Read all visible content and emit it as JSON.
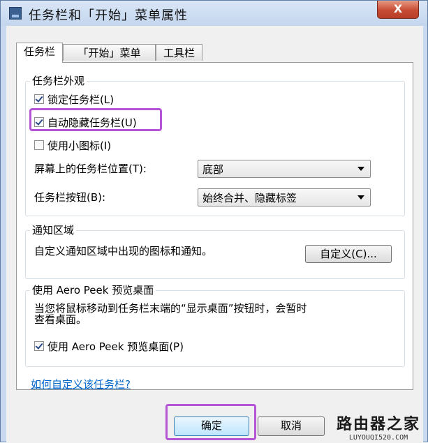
{
  "window": {
    "title": "任务栏和「开始」菜单属性",
    "close_label": "X"
  },
  "tabs": [
    {
      "label": "任务栏",
      "active": true
    },
    {
      "label": "「开始」菜单",
      "active": false
    },
    {
      "label": "工具栏",
      "active": false
    }
  ],
  "appearance": {
    "title": "任务栏外观",
    "lock": {
      "label": "锁定任务栏(L)",
      "checked": true
    },
    "autohide": {
      "label": "自动隐藏任务栏(U)",
      "checked": true
    },
    "small_icons": {
      "label": "使用小图标(I)",
      "checked": false
    },
    "position": {
      "label": "屏幕上的任务栏位置(T):",
      "value": "底部"
    },
    "buttons": {
      "label": "任务栏按钮(B):",
      "value": "始终合并、隐藏标签"
    }
  },
  "notification": {
    "title": "通知区域",
    "text": "自定义通知区域中出现的图标和通知。",
    "button": "自定义(C)..."
  },
  "aero_peek": {
    "title": "使用 Aero Peek 预览桌面",
    "text_line1": "当您将鼠标移动到任务栏末端的“显示桌面”按钮时，会暂时",
    "text_line2": "查看桌面。",
    "checkbox": {
      "label": "使用 Aero Peek 预览桌面(P)",
      "checked": true
    }
  },
  "help_link": "如何自定义该任务栏?",
  "footer": {
    "ok": "确定",
    "cancel": "取消"
  },
  "watermark": {
    "main": "路由器之家",
    "sub": "LUYOUQI520.COM"
  },
  "colors": {
    "highlight": "#b455d6",
    "link": "#0066cc",
    "close": "#c64b33"
  }
}
